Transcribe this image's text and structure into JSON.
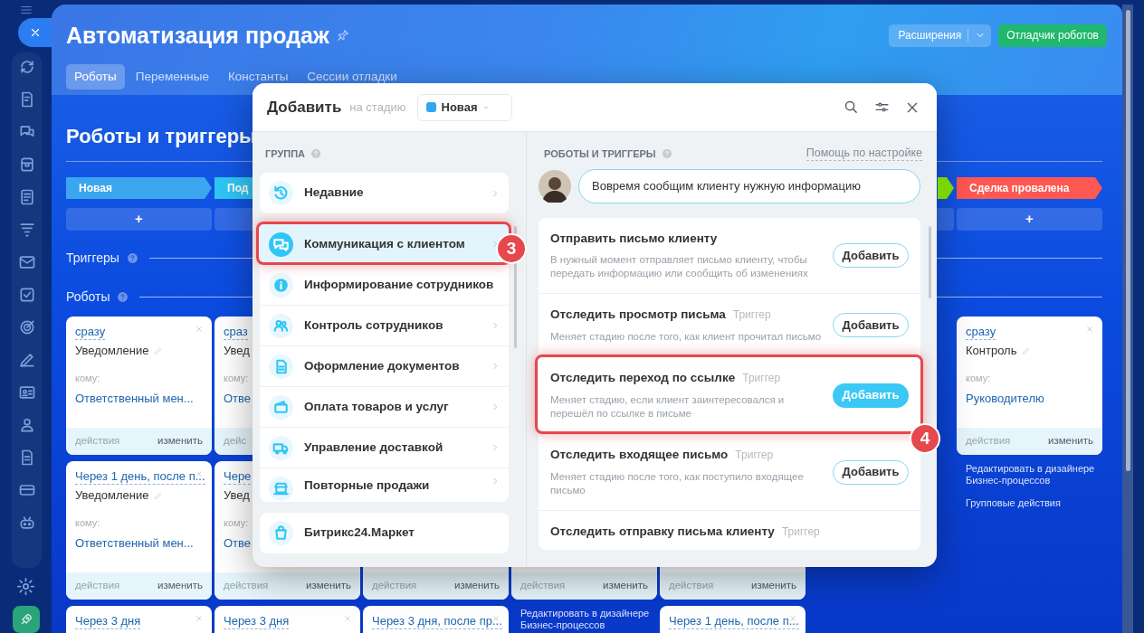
{
  "window": {
    "title": "Автоматизация продаж"
  },
  "tabs": [
    {
      "label": "Роботы",
      "selected": true
    },
    {
      "label": "Переменные",
      "selected": false
    },
    {
      "label": "Константы",
      "selected": false
    },
    {
      "label": "Сессии отладки",
      "selected": false
    }
  ],
  "toolbar": {
    "extensions_button": "Расширения",
    "debugger_button": "Отладчик роботов"
  },
  "section_title": "Роботы и триггеры",
  "triggers_label": "Триггеры",
  "robots_label": "Роботы",
  "columns": [
    {
      "stage": {
        "label": "Новая",
        "color": "#3ba6ee"
      },
      "add_button": "+",
      "cards": [
        {
          "delay": "сразу",
          "type": "Уведомление",
          "editable": true,
          "recipient_label": "кому:",
          "recipient": "Ответственный мен...",
          "actions": "действия",
          "edit": "изменить",
          "closable": true
        },
        {
          "delay": "Через 1 день, после п...",
          "type": "Уведомление",
          "editable": true,
          "recipient_label": "кому:",
          "recipient": "Ответственный мен...",
          "actions": "действия",
          "edit": "изменить",
          "closable": true
        },
        {
          "delay": "Через 3 дня",
          "closable": true
        }
      ]
    },
    {
      "stage": {
        "label": "Под",
        "color": "#2fc6f6"
      },
      "cards": [
        {
          "delay": "сраз",
          "type": "Увед",
          "recipient_label": "кому:",
          "recipient": "Отве",
          "actions": "дейс"
        },
        {
          "delay": "Чере",
          "type": "Увед",
          "recipient_label": "кому:",
          "recipient": "Отве",
          "actions": "действия",
          "edit": "изменить"
        },
        {
          "delay": "Через 3 дня",
          "closable": true
        }
      ]
    },
    {
      "cards": [
        {
          "actions": "действия",
          "edit": "изменить"
        },
        {
          "delay": "Через 3 дня, после пр...",
          "closable": true
        }
      ]
    },
    {
      "cards": [
        {
          "actions": "действия",
          "edit": "изменить"
        }
      ],
      "links": [
        "Редактировать в дизайнере Бизнес-процессов"
      ]
    },
    {
      "cards": [
        {
          "actions": "действия",
          "edit": "изменить"
        },
        {
          "delay": "Через 1 день, после п...",
          "closable": true
        }
      ]
    },
    {
      "stage": {
        "color": "#7bd500"
      }
    },
    {
      "stage": {
        "label": "Сделка провалена",
        "color": "#ff5752"
      },
      "add_button": "+",
      "cards": [
        {
          "delay": "сразу",
          "type": "Контроль",
          "editable": true,
          "recipient_label": "кому:",
          "recipient": "Руководителю",
          "actions": "действия",
          "edit": "изменить",
          "closable": true
        }
      ],
      "links": [
        "Редактировать в дизайнере Бизнес-процессов",
        "Групповые действия"
      ]
    }
  ],
  "dialog": {
    "title": "Добавить",
    "stage_prompt": "на стадию",
    "stage": {
      "label": "Новая",
      "color": "#2fa6f0"
    },
    "group_heading": "ГРУППА",
    "robots_heading": "РОБОТЫ И ТРИГГЕРЫ",
    "help_link": "Помощь по настройке",
    "hint": "Вовремя сообщим клиенту нужную информацию",
    "group_cards": [
      {
        "items": [
          {
            "label": "Недавние",
            "selected": false
          }
        ]
      },
      {
        "items": [
          {
            "label": "Коммуникация с клиентом",
            "selected": true,
            "callout": "3"
          },
          {
            "label": "Информирование сотрудников",
            "selected": false
          },
          {
            "label": "Контроль сотрудников",
            "selected": false
          },
          {
            "label": "Оформление документов",
            "selected": false
          },
          {
            "label": "Оплата товаров и услуг",
            "selected": false
          },
          {
            "label": "Управление доставкой",
            "selected": false
          },
          {
            "label": "Повторные продажи",
            "selected": false
          }
        ]
      },
      {
        "items": [
          {
            "label": "Битрикс24.Маркет",
            "selected": false
          }
        ]
      }
    ],
    "robots": [
      {
        "title": "Отправить письмо клиенту",
        "description": "В нужный момент отправляет письмо клиенту, чтобы передать информацию или сообщить об изменениях",
        "button": "Добавить",
        "primary": false
      },
      {
        "title": "Отследить просмотр письма",
        "tag": "Триггер",
        "description": "Меняет стадию после того, как клиент прочитал письмо",
        "button": "Добавить",
        "primary": false
      },
      {
        "title": "Отследить переход по ссылке",
        "tag": "Триггер",
        "description": "Меняет стадию, если клиент заинтересовался и перешёл по ссылке в письме",
        "button": "Добавить",
        "primary": true,
        "callout": "4"
      },
      {
        "title": "Отследить входящее письмо",
        "tag": "Триггер",
        "description": "Меняет стадию после того, как поступило входящее письмо",
        "button": "Добавить",
        "primary": false
      },
      {
        "title": "Отследить отправку письма клиенту",
        "tag": "Триггер"
      }
    ]
  }
}
